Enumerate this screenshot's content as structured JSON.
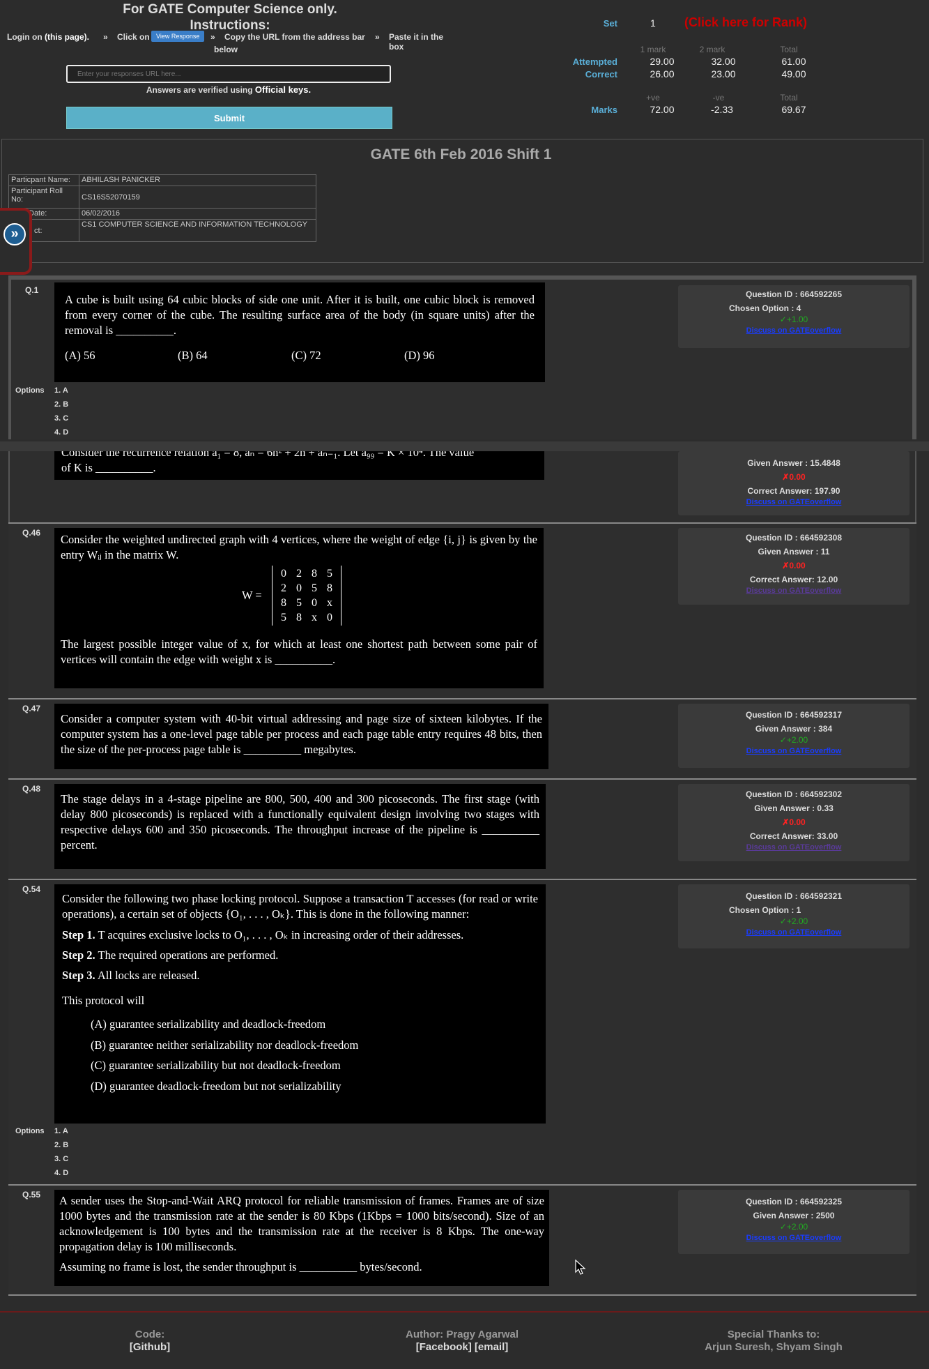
{
  "header": {
    "title1": "For GATE Computer Science only.",
    "title2": "Instructions:",
    "step1a": "Login on",
    "step1b": "(this page).",
    "sep": "»",
    "step2": "Click on",
    "view_response": "View Response",
    "step3": "Copy the URL from the address bar",
    "step4": "Paste it in the box",
    "below": "below",
    "url_placeholder": "Enter your responses URL here...",
    "verified_a": "Answers are verified using",
    "verified_b": "Official keys.",
    "submit": "Submit"
  },
  "score": {
    "set_label": "Set",
    "set_value": "1",
    "rank_link": "(Click here for Rank)",
    "col1": "1 mark",
    "col2": "2 mark",
    "col3": "Total",
    "attempted_label": "Attempted",
    "attempted": [
      "29.00",
      "32.00",
      "61.00"
    ],
    "correct_label": "Correct",
    "correct": [
      "26.00",
      "23.00",
      "49.00"
    ],
    "pos": "+ve",
    "neg": "-ve",
    "tot": "Total",
    "marks_label": "Marks",
    "marks": [
      "72.00",
      "-2.33",
      "69.67"
    ]
  },
  "exam": {
    "title": "GATE 6th Feb 2016 Shift 1",
    "rows": [
      {
        "k": "Particpant Name:",
        "v": "ABHILASH PANICKER"
      },
      {
        "k": "Participant Roll No:",
        "v": "CS16S52070159"
      },
      {
        "k": "Date:",
        "v": "06/02/2016"
      },
      {
        "k": "ct:",
        "v": "CS1 COMPUTER SCIENCE AND INFORMATION TECHNOLOGY"
      }
    ]
  },
  "options_label": "Options",
  "option_list": [
    "1. A",
    "2. B",
    "3. C",
    "4. D"
  ],
  "questions": {
    "q1": {
      "num": "Q.1",
      "text": "A cube is built using 64 cubic blocks of side one unit. After it is built, one cubic block is removed from every corner of the cube. The resulting surface area of the body (in square units) after the removal is __________.",
      "opts": [
        "(A)  56",
        "(B)  64",
        "(C)  72",
        "(D)  96"
      ],
      "qid": "Question ID : 664592265",
      "chosen": "Chosen Option : 4",
      "mark": "✓+1.00",
      "discuss": "Discuss on GATEoverflow"
    },
    "q45": {
      "partial": "Consider the recurrence relation a₁ = 8, aₙ = 6n² + 2n + aₙ₋₁. Let a₉₉ = K × 10⁴. The value",
      "text": "of K is __________.",
      "given": "Given Answer : 15.4848",
      "mark": "✗0.00",
      "correct": "Correct Answer: 197.90",
      "discuss": "Discuss on GATEoverflow"
    },
    "q46": {
      "num": "Q.46",
      "text1": "Consider the weighted undirected graph with 4 vertices, where the weight of edge {i, j} is given by the entry Wᵢⱼ in the matrix W.",
      "wlabel": "W =",
      "matrix": [
        [
          "0",
          "2",
          "8",
          "5"
        ],
        [
          "2",
          "0",
          "5",
          "8"
        ],
        [
          "8",
          "5",
          "0",
          "x"
        ],
        [
          "5",
          "8",
          "x",
          "0"
        ]
      ],
      "text2": "The largest possible integer value of x, for which at least one shortest path between some pair of vertices will contain the edge with weight x is __________.",
      "qid": "Question ID : 664592308",
      "given": "Given Answer : 11",
      "mark": "✗0.00",
      "correct": "Correct Answer: 12.00",
      "discuss": "Discuss on GATEoverflow"
    },
    "q47": {
      "num": "Q.47",
      "text": "Consider a computer system with 40-bit virtual addressing and page size of sixteen kilobytes. If the computer system has a one-level page table per process and each page table entry requires 48 bits, then the size of the per-process page table is __________ megabytes.",
      "qid": "Question ID : 664592317",
      "given": "Given Answer : 384",
      "mark": "✓+2.00",
      "discuss": "Discuss on GATEoverflow"
    },
    "q48": {
      "num": "Q.48",
      "text": "The stage delays in a 4-stage pipeline are 800, 500, 400 and 300 picoseconds. The first stage (with delay 800 picoseconds) is replaced with a functionally equivalent design involving two stages with respective delays 600 and 350 picoseconds. The throughput increase of the pipeline is __________ percent.",
      "qid": "Question ID : 664592302",
      "given": "Given Answer : 0.33",
      "mark": "✗0.00",
      "correct": "Correct Answer: 33.00",
      "discuss": "Discuss on GATEoverflow"
    },
    "q54": {
      "num": "Q.54",
      "text": "Consider the following two phase locking protocol. Suppose a transaction T accesses (for read or write operations), a certain set of objects {O₁, . . . , Oₖ}. This is done in the following manner:",
      "s1k": "Step 1.",
      "s1": "T acquires exclusive locks to O₁, . . . , Oₖ in increasing order of their addresses.",
      "s2k": "Step 2.",
      "s2": "The required operations are performed.",
      "s3k": "Step 3.",
      "s3": "All locks are released.",
      "will": "This protocol will",
      "opts": [
        "(A)  guarantee serializability and deadlock-freedom",
        "(B)  guarantee neither serializability nor deadlock-freedom",
        "(C)  guarantee serializability but not deadlock-freedom",
        "(D)  guarantee deadlock-freedom but not serializability"
      ],
      "qid": "Question ID : 664592321",
      "chosen": "Chosen Option : 1",
      "mark": "✓+2.00",
      "discuss": "Discuss on GATEoverflow"
    },
    "q55": {
      "num": "Q.55",
      "text": "A sender uses the Stop-and-Wait ARQ protocol for reliable transmission of frames. Frames are of size 1000 bytes and the transmission rate at the sender is 80 Kbps (1Kbps = 1000 bits/second). Size of an acknowledgement is 100 bytes and the transmission rate at the receiver is 8 Kbps. The one-way propagation delay is 100 milliseconds.",
      "text2": "Assuming no frame is lost, the sender throughput is __________ bytes/second.",
      "qid": "Question ID : 664592325",
      "given": "Given Answer : 2500",
      "mark": "✓+2.00",
      "discuss": "Discuss on GATEoverflow"
    }
  },
  "footer": {
    "code": "Code:",
    "github": "[Github]",
    "author": "Author: Pragy Agarwal",
    "links": "[Facebook] [email]",
    "thanks": "Special Thanks to:",
    "names": "Arjun Suresh, Shyam Singh"
  }
}
